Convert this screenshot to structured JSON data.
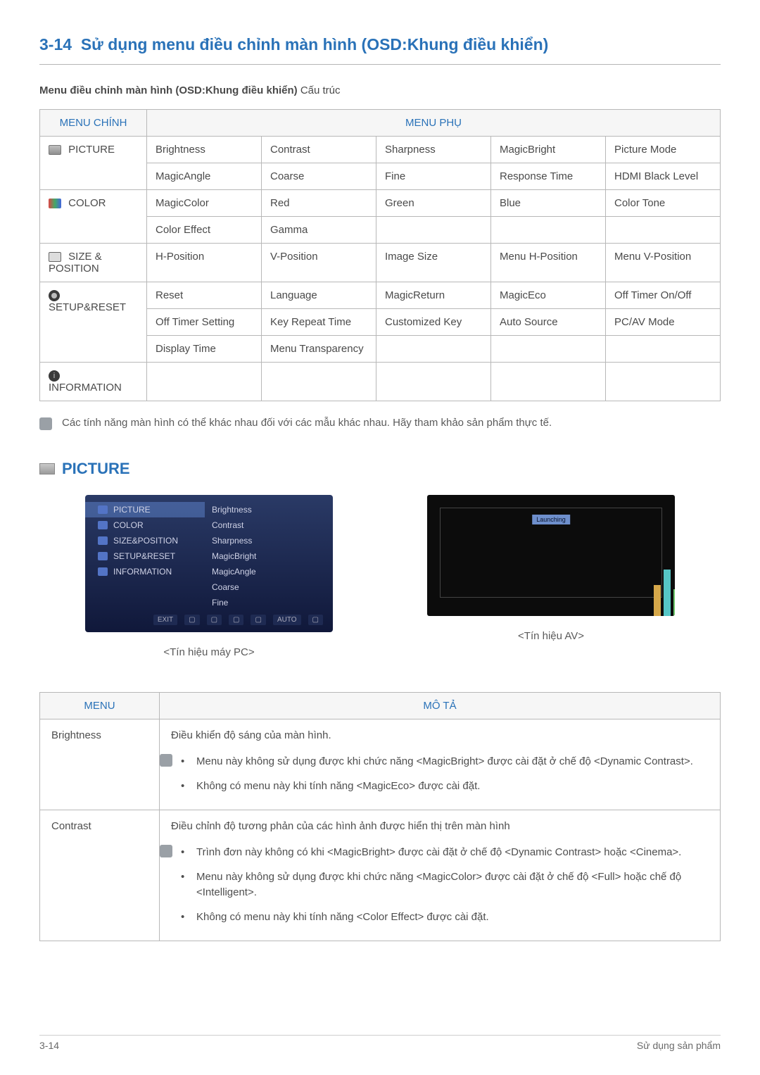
{
  "header": {
    "section_number": "3-14",
    "section_title": "Sử dụng menu điều chỉnh màn hình (OSD:Khung điều khiển)",
    "subtitle_bold": "Menu điều chỉnh màn hình (OSD:Khung điều khiển)",
    "subtitle_rest": " Cấu trúc"
  },
  "menu_table": {
    "header_main": "MENU CHÍNH",
    "header_sub": "MENU PHỤ",
    "rows": [
      {
        "main": "PICTURE",
        "subs": [
          [
            "Brightness",
            "Contrast",
            "Sharpness",
            "MagicBright",
            "Picture Mode"
          ],
          [
            "MagicAngle",
            "Coarse",
            "Fine",
            "Response Time",
            "HDMI Black Level"
          ]
        ]
      },
      {
        "main": "COLOR",
        "subs": [
          [
            "MagicColor",
            "Red",
            "Green",
            "Blue",
            "Color Tone"
          ],
          [
            "Color Effect",
            "Gamma",
            "",
            "",
            ""
          ]
        ]
      },
      {
        "main": "SIZE & POSITION",
        "subs": [
          [
            "H-Position",
            "V-Position",
            "Image Size",
            "Menu H-Position",
            "Menu V-Position"
          ]
        ]
      },
      {
        "main": "SETUP&RESET",
        "subs": [
          [
            "Reset",
            "Language",
            "MagicReturn",
            "MagicEco",
            "Off Timer On/Off"
          ],
          [
            "Off Timer Setting",
            "Key Repeat Time",
            "Customized Key",
            "Auto Source",
            "PC/AV Mode"
          ],
          [
            "Display Time",
            "Menu Transparency",
            "",
            "",
            ""
          ]
        ]
      },
      {
        "main": "INFORMATION",
        "subs": [
          [
            "",
            "",
            "",
            "",
            ""
          ]
        ]
      }
    ]
  },
  "note": "Các tính năng màn hình có thể khác nhau đối với các mẫu khác nhau. Hãy tham khảo sản phẩm thực tế.",
  "picture_heading": "PICTURE",
  "osd_menu": {
    "items": [
      "PICTURE",
      "COLOR",
      "SIZE&POSITION",
      "SETUP&RESET",
      "INFORMATION"
    ],
    "sub_items": [
      "Brightness",
      "Contrast",
      "Sharpness",
      "MagicBright",
      "MagicAngle",
      "Coarse",
      "Fine"
    ],
    "bottom_labels": [
      "EXIT",
      "",
      "",
      "",
      "",
      "AUTO",
      ""
    ]
  },
  "caption_pc": "<Tín hiệu máy PC>",
  "caption_av": "<Tín hiệu AV>",
  "desc_table": {
    "header_menu": "MENU",
    "header_desc": "MÔ TẢ",
    "rows": [
      {
        "menu": "Brightness",
        "intro": "Điều khiển độ sáng của màn hình.",
        "bullets": [
          "Menu này không sử dụng được khi chức năng <MagicBright> được cài đặt ở chế độ <Dynamic Contrast>.",
          "Không có menu này khi tính năng <MagicEco> được cài đặt."
        ]
      },
      {
        "menu": "Contrast",
        "intro": "Điều chỉnh độ tương phản của các hình ảnh được hiển thị trên màn hình",
        "bullets": [
          "Trình đơn này không có khi <MagicBright> được cài đặt ở chế độ <Dynamic Contrast> hoặc <Cinema>.",
          "Menu này không sử dụng được khi chức năng <MagicColor> được cài đặt ở chế độ <Full> hoặc chế độ <Intelligent>.",
          "Không có menu này khi tính năng <Color Effect> được cài đặt."
        ]
      }
    ]
  },
  "footer": {
    "left": "3-14",
    "right": "Sử dụng sản phẩm"
  }
}
